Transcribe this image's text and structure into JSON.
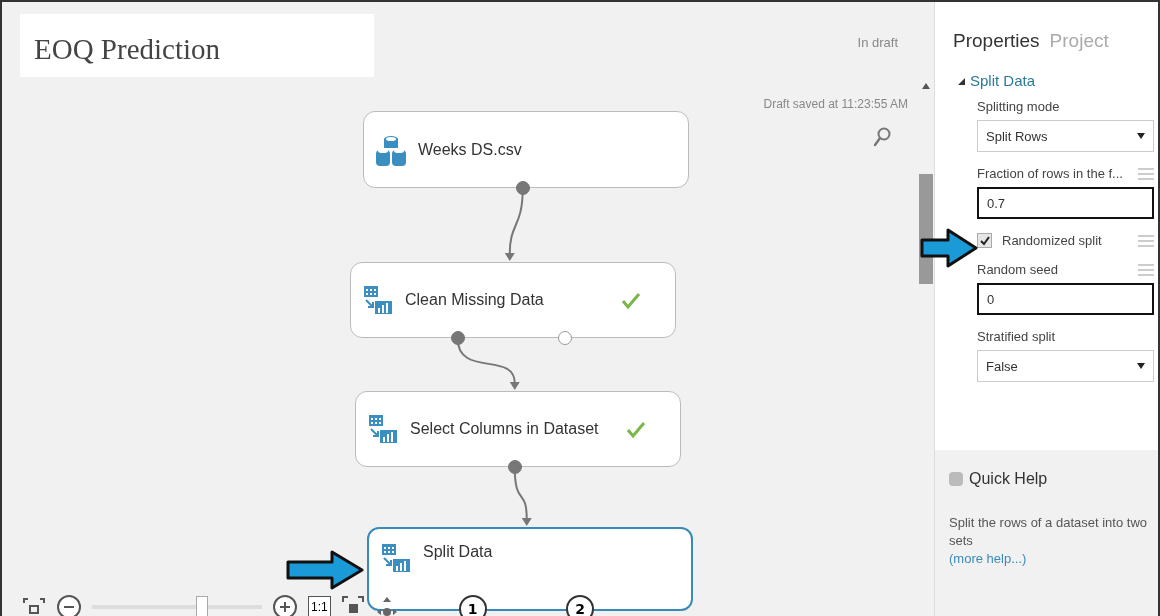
{
  "experiment": {
    "title": "EOQ Prediction",
    "status": "In draft",
    "saved": "Draft saved at 11:23:55 AM"
  },
  "nodes": [
    {
      "name": "Weeks DS.csv",
      "kind": "dataset",
      "done": false,
      "selected": false,
      "outputs": [
        {
          "connected": true
        }
      ]
    },
    {
      "name": "Clean Missing Data",
      "kind": "module",
      "done": true,
      "selected": false,
      "outputs": [
        {
          "connected": true
        },
        {
          "connected": false
        }
      ]
    },
    {
      "name": "Select Columns in Dataset",
      "kind": "module",
      "done": true,
      "selected": false,
      "outputs": [
        {
          "connected": true
        }
      ]
    },
    {
      "name": "Split Data",
      "kind": "module",
      "done": false,
      "selected": true,
      "outputs": [
        {
          "connected": false,
          "label": "1"
        },
        {
          "connected": false,
          "label": "2"
        }
      ]
    }
  ],
  "zoom": {
    "level": 0.64,
    "actual_size": "1:1"
  },
  "properties": {
    "tabs": [
      {
        "label": "Properties",
        "selected": true
      },
      {
        "label": "Project",
        "selected": false
      }
    ],
    "section": {
      "title": "Split Data",
      "expanded": true
    },
    "fields": [
      {
        "kind": "select",
        "label": "Splitting mode",
        "value": "Split Rows",
        "menu": false,
        "emphasized": false
      },
      {
        "kind": "text",
        "label": "Fraction of rows in the f...",
        "value": "0.7",
        "menu": true,
        "emphasized": true
      },
      {
        "kind": "checkbox",
        "label": "Randomized split",
        "checked": true,
        "menu": true
      },
      {
        "kind": "text",
        "label": "Random seed",
        "value": "0",
        "menu": true,
        "emphasized": true
      },
      {
        "kind": "select",
        "label": "Stratified split",
        "value": "False",
        "menu": false,
        "emphasized": false
      }
    ]
  },
  "quick_help": {
    "title": "Quick Help",
    "text": "Split the rows of a dataset into two sets",
    "link": "(more help...)"
  }
}
